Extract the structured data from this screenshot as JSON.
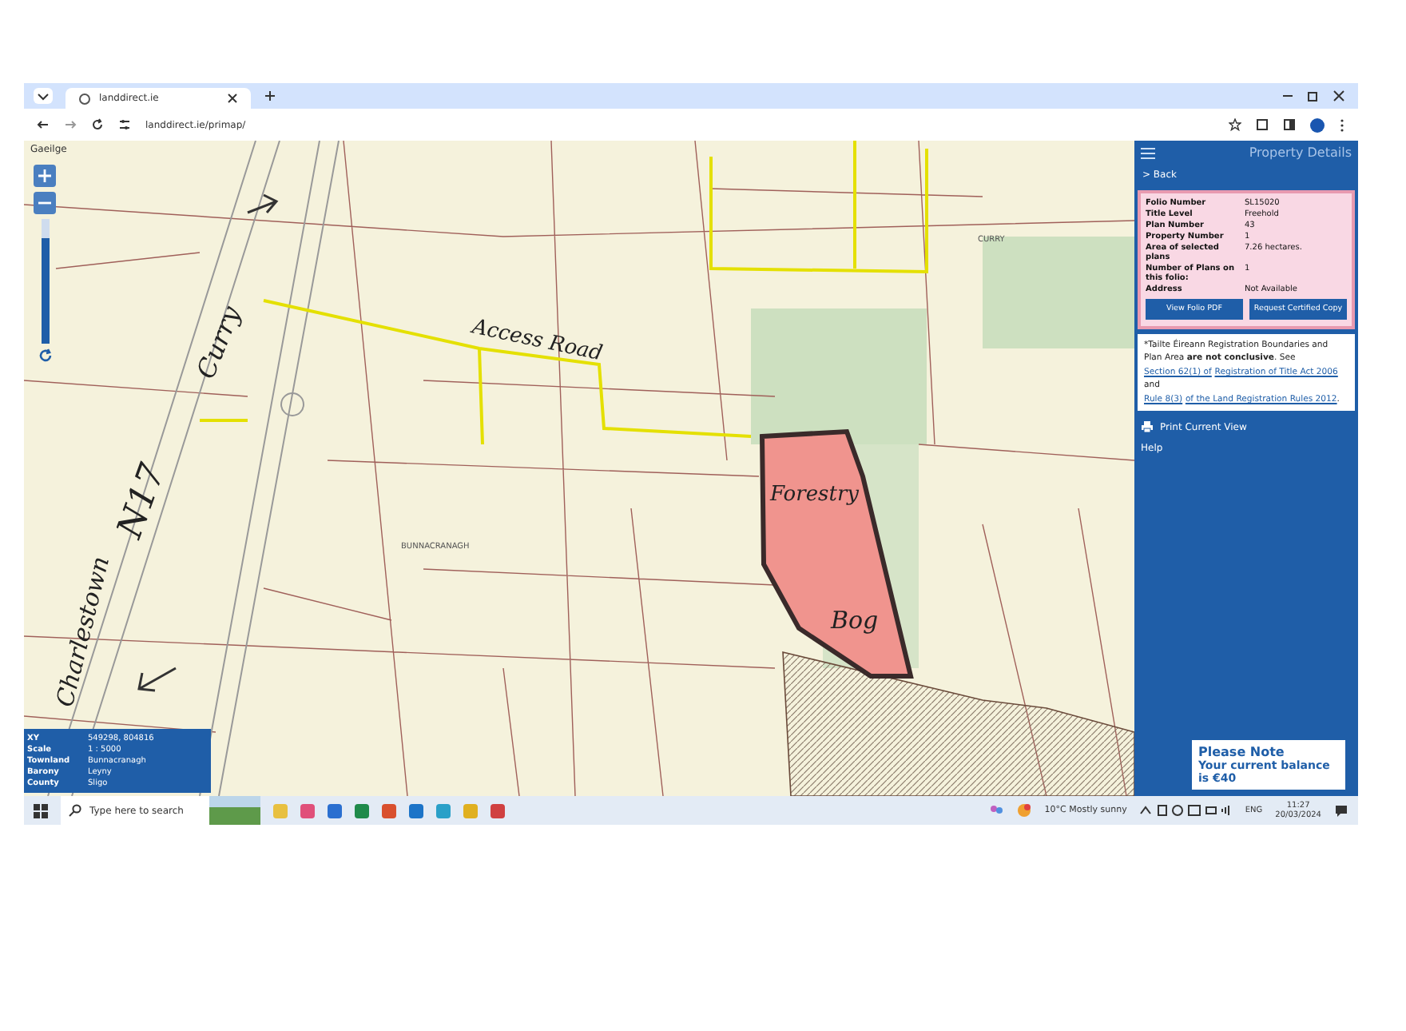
{
  "browser": {
    "tab_title": "landdirect.ie",
    "url": "landdirect.ie/primap/"
  },
  "map": {
    "language_link": "Gaeilge",
    "zoom": {
      "level": 0.85
    },
    "place_labels": [
      "CURRY",
      "BUNNACRANAGH"
    ],
    "annotations": [
      {
        "kind": "access",
        "text": "Access Road"
      },
      {
        "kind": "curry",
        "text": "Curry"
      },
      {
        "kind": "road",
        "text": "N17"
      },
      {
        "kind": "town",
        "text": "Charlestown"
      },
      {
        "kind": "forestry",
        "text": "Forestry"
      },
      {
        "kind": "bog",
        "text": "Bog"
      }
    ],
    "info": [
      {
        "label": "XY",
        "value": "549298, 804816"
      },
      {
        "label": "Scale",
        "value": "1 : 5000"
      },
      {
        "label": "Townland",
        "value": "Bunnacranagh"
      },
      {
        "label": "Barony",
        "value": "Leyny"
      },
      {
        "label": "County",
        "value": "Sligo"
      }
    ]
  },
  "panel": {
    "title": "Property Details",
    "back": "> Back",
    "fields": [
      {
        "label": "Folio Number",
        "value": "SL15020"
      },
      {
        "label": "Title Level",
        "value": "Freehold"
      },
      {
        "label": "Plan Number",
        "value": "43"
      },
      {
        "label": "Property Number",
        "value": "1"
      },
      {
        "label": "Area of selected plans",
        "value": "7.26 hectares."
      },
      {
        "label": "Number of Plans on this folio:",
        "value": "1"
      },
      {
        "label": "Address",
        "value": "Not Available"
      }
    ],
    "buttons": [
      "View Folio PDF",
      "Request Certified Copy"
    ],
    "disclaimer": [
      {
        "kind": "text",
        "text": "*Tailte Éireann Registration Boundaries and Plan Area "
      },
      {
        "kind": "bold",
        "text": "are not conclusive"
      },
      {
        "kind": "text",
        "text": ". See "
      },
      {
        "kind": "link",
        "text": "Section 62(1) of"
      },
      {
        "kind": "link",
        "text": "Registration of Title Act 2006"
      },
      {
        "kind": "text",
        "text": " and "
      },
      {
        "kind": "link",
        "text": "Rule 8(3)"
      },
      {
        "kind": "link",
        "text": "of the Land Registration Rules 2012"
      },
      {
        "kind": "text",
        "text": "."
      }
    ],
    "links": [
      {
        "kind": "print",
        "label": "Print Current View"
      },
      {
        "kind": "plain",
        "label": "Help"
      }
    ],
    "note": {
      "title": "Please Note",
      "text": "Your current balance is €40"
    }
  },
  "taskbar": {
    "search_placeholder": "Type here to search",
    "weather": "10°C  Mostly sunny",
    "language": "ENG",
    "time": "11:27",
    "date": "20/03/2024"
  }
}
